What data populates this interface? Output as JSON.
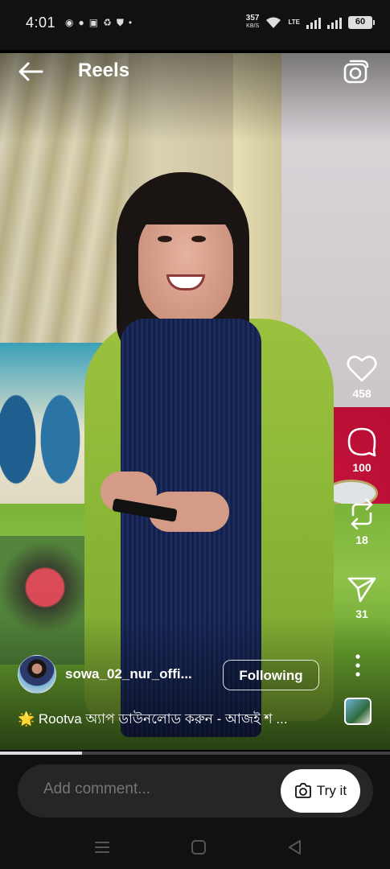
{
  "status_bar": {
    "time": "4:01",
    "net_speed_value": "357",
    "net_speed_unit": "KB/S",
    "lte_label": "LTE",
    "battery": "60"
  },
  "header": {
    "title": "Reels",
    "back_icon": "arrow-left-icon",
    "camera_icon": "camera-icon"
  },
  "actions": {
    "likes": "458",
    "comments": "100",
    "reposts": "18",
    "shares": "31"
  },
  "author": {
    "username": "sowa_02_nur_offi...",
    "follow_label": "Following"
  },
  "caption": "🌟 Rootva অ্যাপ ডাউনলোড করুন - আজই শ ...",
  "progress": 0.21,
  "comment": {
    "placeholder": "Add comment...",
    "try_label": "Try it"
  },
  "colors": {
    "background": "#000000",
    "comment_bar": "#262626",
    "text": "#ffffff"
  }
}
